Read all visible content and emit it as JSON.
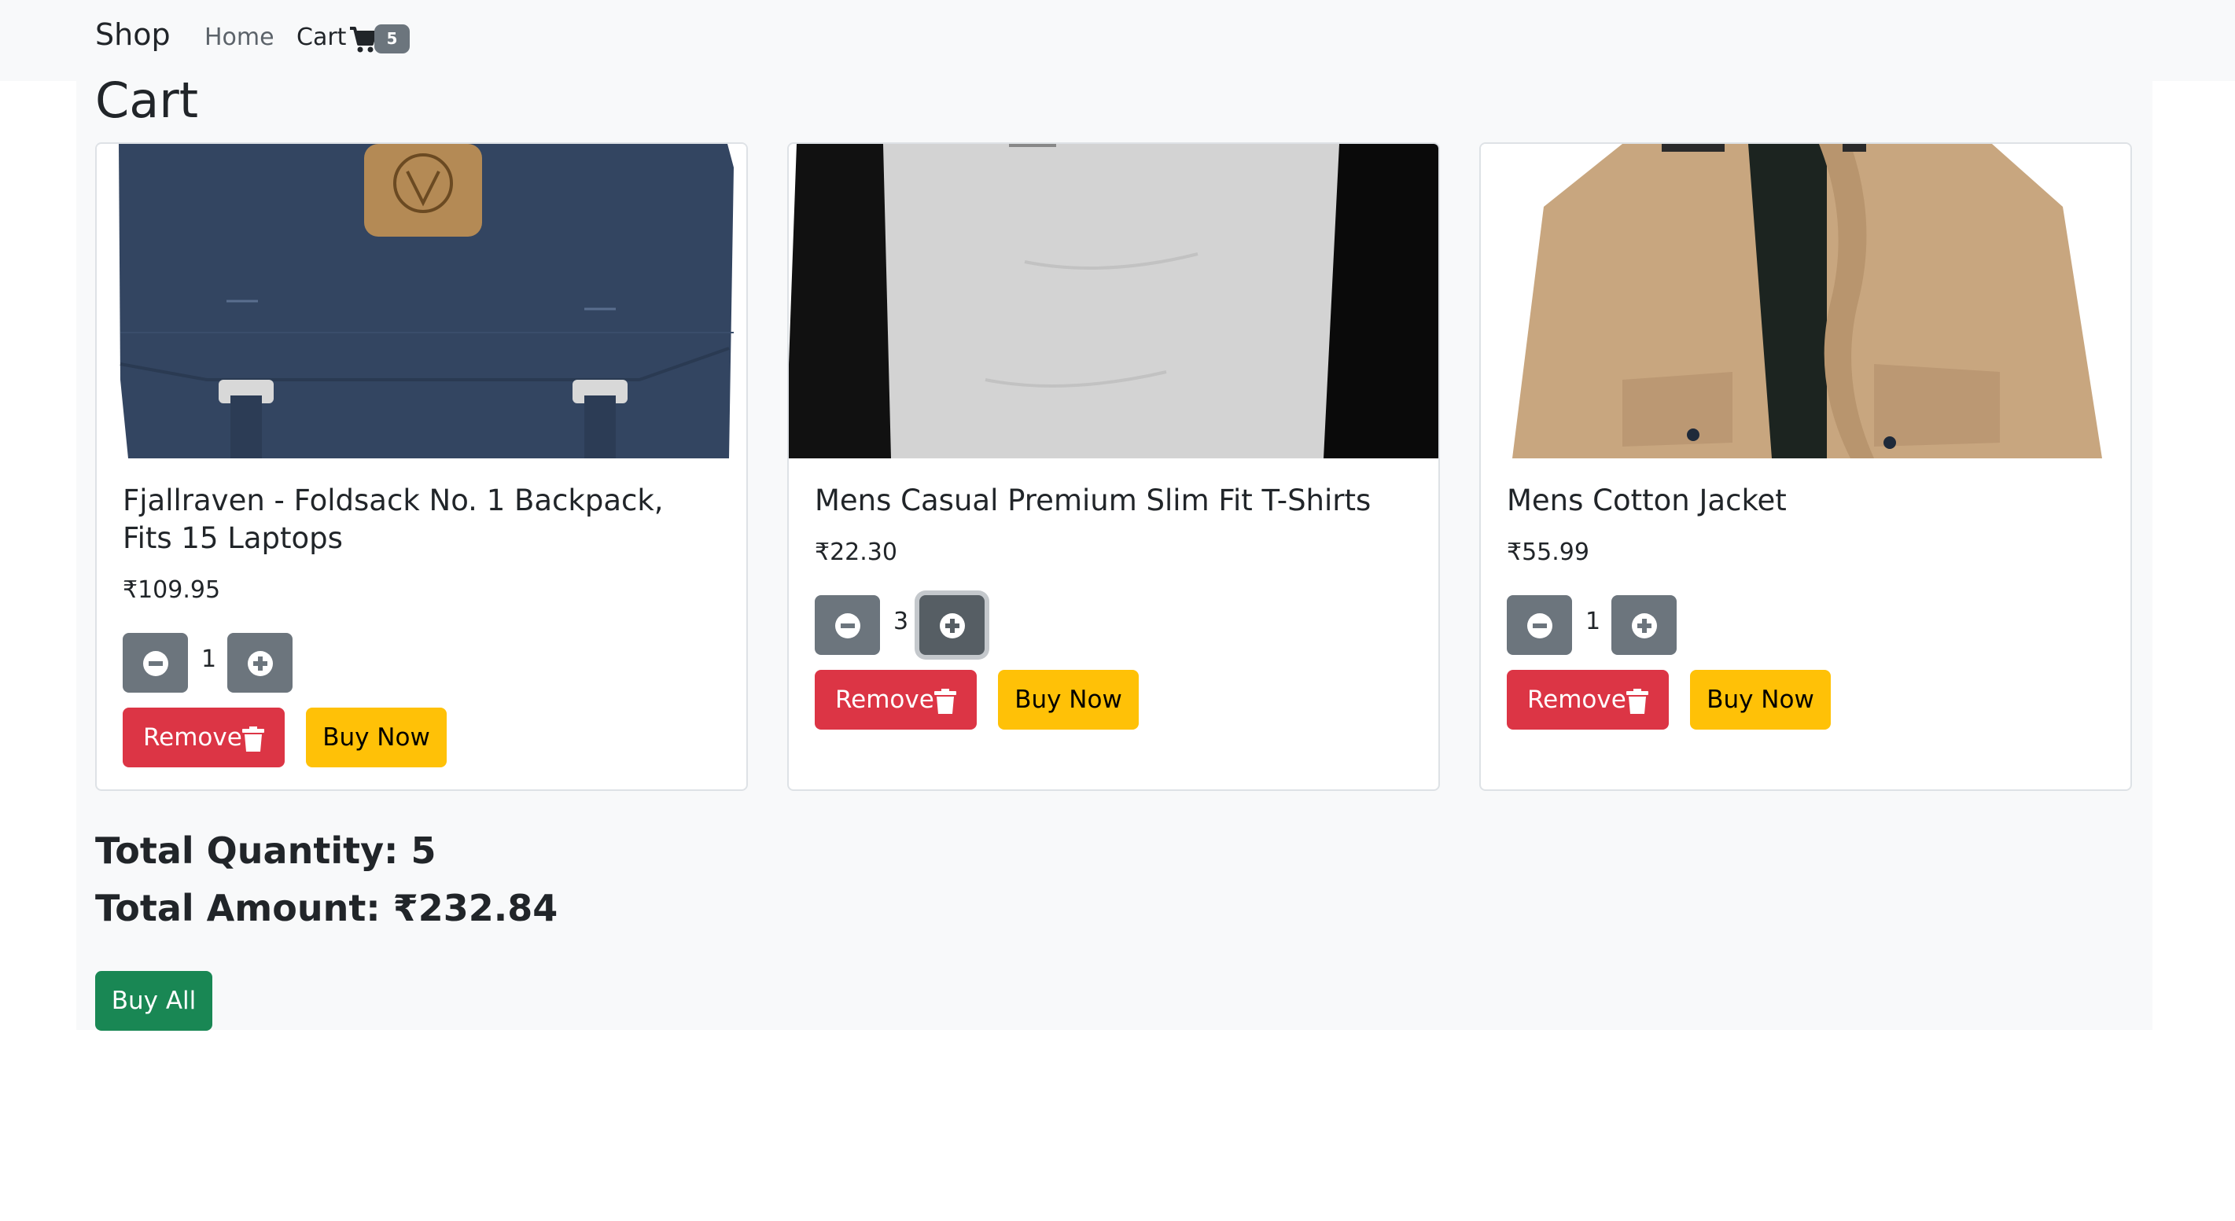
{
  "navbar": {
    "brand": "Shop",
    "home_label": "Home",
    "cart_label": "Cart",
    "cart_icon": "shopping-cart-icon",
    "cart_count": "5"
  },
  "page": {
    "title": "Cart"
  },
  "items": [
    {
      "title": "Fjallraven - Foldsack No. 1 Backpack, Fits 15 Laptops",
      "price": "₹109.95",
      "quantity": "1",
      "remove_label": "Remove",
      "buy_label": "Buy Now"
    },
    {
      "title": "Mens Casual Premium Slim Fit T-Shirts",
      "price": "₹22.30",
      "quantity": "3",
      "remove_label": "Remove",
      "buy_label": "Buy Now"
    },
    {
      "title": "Mens Cotton Jacket",
      "price": "₹55.99",
      "quantity": "1",
      "remove_label": "Remove",
      "buy_label": "Buy Now"
    }
  ],
  "summary": {
    "total_quantity": "Total Quantity: 5",
    "total_amount": "Total Amount: ₹232.84",
    "buy_all_label": "Buy All"
  },
  "icons": {
    "decrement": "minus-circle-icon",
    "increment": "plus-circle-icon",
    "remove": "trash-icon"
  },
  "colors": {
    "danger": "#dc3545",
    "warning": "#ffc107",
    "success": "#198754",
    "secondary": "#6c757d"
  }
}
